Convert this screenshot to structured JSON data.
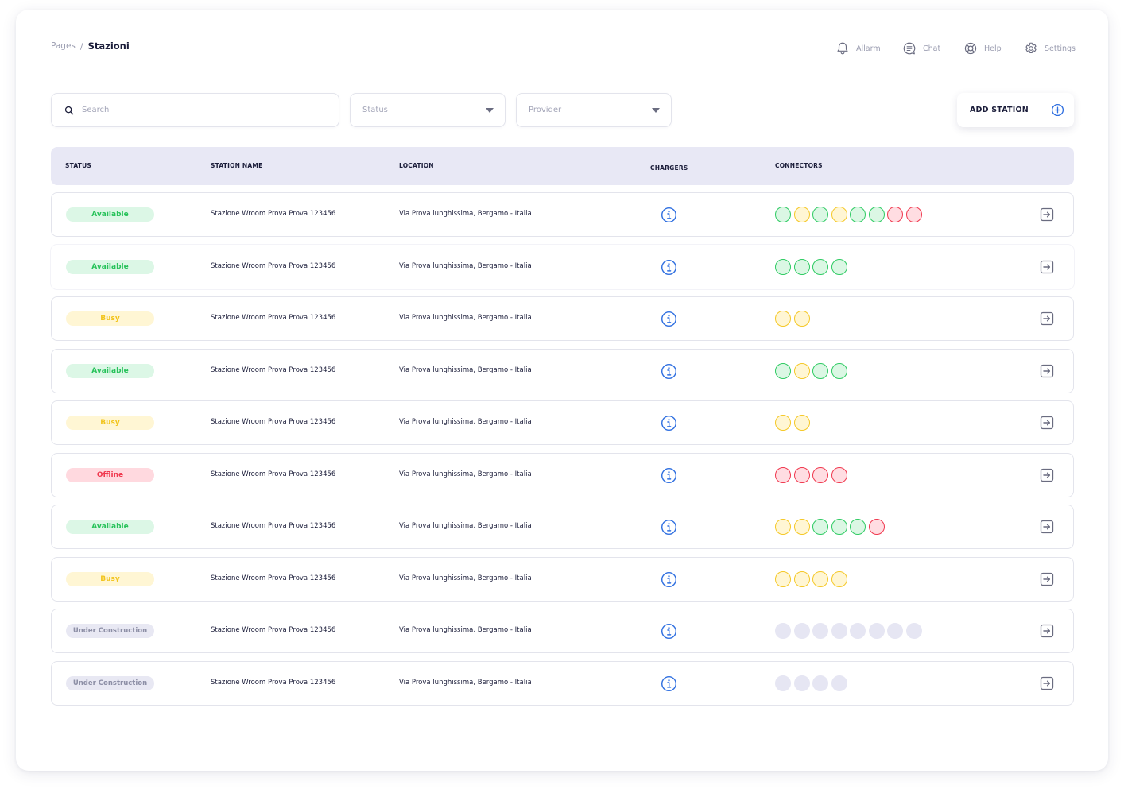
{
  "breadcrumb": {
    "root": "Pages",
    "separator": "/",
    "current": "Stazioni"
  },
  "topnav": {
    "alarm": {
      "label": "Allarm",
      "icon": "bell-icon"
    },
    "chat": {
      "label": "Chat",
      "icon": "chat-icon"
    },
    "help": {
      "label": "Help",
      "icon": "lifebuoy-icon"
    },
    "settings": {
      "label": "Settings",
      "icon": "gear-icon"
    }
  },
  "filters": {
    "search_placeholder": "Search",
    "status_placeholder": "Status",
    "provider_placeholder": "Provider"
  },
  "add_station": {
    "label": "ADD STATION",
    "icon": "plus-circle-icon"
  },
  "table": {
    "headers": {
      "status": "STATUS",
      "station_name": "STATION NAME",
      "location": "LOCATION",
      "chargers": "CHARGERS",
      "connectors": "CONNECTORS"
    },
    "rows": [
      {
        "status": "Available",
        "name": "Stazione Wroom Prova Prova 123456",
        "location": "Via Prova lunghissima, Bergamo - Italia",
        "connectors": [
          "green",
          "yellow",
          "green",
          "yellow",
          "green",
          "green",
          "red",
          "red"
        ]
      },
      {
        "status": "Available",
        "name": "Stazione Wroom Prova Prova 123456",
        "location": "Via Prova lunghissima, Bergamo - Italia",
        "connectors": [
          "green",
          "green",
          "green",
          "green"
        ]
      },
      {
        "status": "Busy",
        "name": "Stazione Wroom Prova Prova 123456",
        "location": "Via Prova lunghissima, Bergamo - Italia",
        "connectors": [
          "yellow",
          "yellow"
        ]
      },
      {
        "status": "Available",
        "name": "Stazione Wroom Prova Prova 123456",
        "location": "Via Prova lunghissima, Bergamo - Italia",
        "connectors": [
          "green",
          "yellow",
          "green",
          "green"
        ]
      },
      {
        "status": "Busy",
        "name": "Stazione Wroom Prova Prova 123456",
        "location": "Via Prova lunghissima, Bergamo - Italia",
        "connectors": [
          "yellow",
          "yellow"
        ]
      },
      {
        "status": "Offline",
        "name": "Stazione Wroom Prova Prova 123456",
        "location": "Via Prova lunghissima, Bergamo - Italia",
        "connectors": [
          "red",
          "red",
          "red",
          "red"
        ]
      },
      {
        "status": "Available",
        "name": "Stazione Wroom Prova Prova 123456",
        "location": "Via Prova lunghissima, Bergamo - Italia",
        "connectors": [
          "yellow",
          "yellow",
          "green",
          "green",
          "green",
          "red"
        ]
      },
      {
        "status": "Busy",
        "name": "Stazione Wroom Prova Prova 123456",
        "location": "Via Prova lunghissima, Bergamo - Italia",
        "connectors": [
          "yellow",
          "yellow",
          "yellow",
          "yellow"
        ]
      },
      {
        "status": "Under Construction",
        "name": "Stazione Wroom Prova Prova 123456",
        "location": "Via Prova lunghissima, Bergamo - Italia",
        "connectors": [
          "none",
          "none",
          "none",
          "none",
          "none",
          "none",
          "none",
          "none"
        ]
      },
      {
        "status": "Under Construction",
        "name": "Stazione Wroom Prova Prova 123456",
        "location": "Via Prova lunghissima, Bergamo - Italia",
        "connectors": [
          "none",
          "none",
          "none",
          "none"
        ]
      }
    ]
  },
  "colors": {
    "accent": "#2f6fe0",
    "available": "#27c25a",
    "busy": "#f2c41d",
    "offline": "#f0384e",
    "construction": "#8d8fa6",
    "header_bg": "#e8e8f5"
  }
}
